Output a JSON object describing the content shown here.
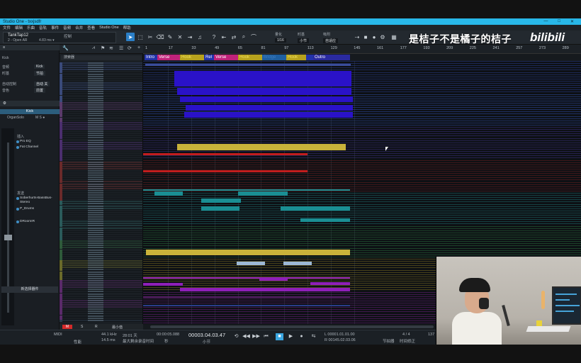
{
  "window": {
    "title": "Studio One - txxjsdfr",
    "controls": [
      "—",
      "□",
      "✕"
    ]
  },
  "menu": [
    "文件",
    "编辑",
    "乐曲",
    "音轨",
    "事件",
    "音频",
    "合并",
    "查看",
    "Studio One",
    "帮助"
  ],
  "toolbar": {
    "song_name": "TankTap12",
    "song_sub": "2 - Open AR",
    "latency": "4.83 ms ▾",
    "control_label": "控制",
    "tools": [
      "arrow",
      "range",
      "split",
      "eraser",
      "paint",
      "mute",
      "bend",
      "listen"
    ],
    "quantize_label": "量化",
    "quantize_value": "1/16",
    "timebase_label": "时基",
    "timebase_value": "小节",
    "snap_label": "吸附",
    "snap_value": "自适应"
  },
  "watermark": {
    "text": "是桔子不是橘子的桔子",
    "logo": "bilibili"
  },
  "inspector": {
    "track_name": "Kick",
    "fields": [
      {
        "label": "音频",
        "value": "Kick"
      },
      {
        "label": "时基",
        "value": "节拍"
      },
      {
        "label": "自动控制",
        "value": "自动 关"
      },
      {
        "label": "音色",
        "value": "前置"
      }
    ],
    "channel_tab": "Kick",
    "channel_sub": "OrganSolo",
    "input_label": "插入",
    "inserts": [
      "Pro EQ",
      "Fat Channel"
    ],
    "sends_label": "发送",
    "sends": [
      "Soberhurts-BassBus-Stereo",
      "P_Drums",
      "DRoomIR"
    ],
    "bottom_button": "新选择器件"
  },
  "track_list": {
    "search_placeholder": "搜索器",
    "track_colors": [
      "#3a4a7a",
      "#3a4a7a",
      "#5a3a6a",
      "#4b2e6e",
      "#4b2e6e",
      "#6a2a2a",
      "#6a2a2a",
      "#2a5a5a",
      "#2a5a5a",
      "#2e5a3a",
      "#6a6a2a",
      "#5a2a6a",
      "#5a2a6a",
      "#2a3a4a"
    ]
  },
  "ruler": {
    "bars": [
      "1",
      "17",
      "33",
      "49",
      "65",
      "81",
      "97",
      "113",
      "129",
      "145",
      "161",
      "177",
      "193",
      "209",
      "225",
      "241",
      "257",
      "273",
      "289"
    ]
  },
  "markers": [
    {
      "label": "Intro",
      "color": "#2233aa",
      "text_color": "#ffffff"
    },
    {
      "label": "Verse",
      "color": "#c0227a",
      "text_color": "#ffffff"
    },
    {
      "label": "Hook",
      "color": "#b7a21d",
      "text_color": "#f0e05a"
    },
    {
      "label": "Rel",
      "color": "#2233aa",
      "text_color": "#ffffff"
    },
    {
      "label": "Verse",
      "color": "#c0227a",
      "text_color": "#ffffff"
    },
    {
      "label": "Hook",
      "color": "#b7a21d",
      "text_color": "#f0e05a"
    },
    {
      "label": "Bridge",
      "color": "#1f5fa0",
      "text_color": "#3c7cc0"
    },
    {
      "label": "Hook",
      "color": "#b7a21d",
      "text_color": "#f0e05a"
    },
    {
      "label": "",
      "color": "#2233aa",
      "text_color": "#ffffff"
    },
    {
      "label": "Outro",
      "color": "#2a2aa0",
      "text_color": "#ffffff"
    }
  ],
  "bottom_tabs": {
    "indicator": "M",
    "items": [
      "S",
      "R",
      "最小值"
    ]
  },
  "transport": {
    "midi_label": "MIDI",
    "perf_label": "性能",
    "sample_rate": "44.1 kHz",
    "latency": "14.5 ms",
    "record_time": "28:01 天",
    "record_time_label": "最大剩余录音时间",
    "seconds": "00:00:05.088",
    "seconds_label": "秒",
    "position": "00003.04.03.47",
    "position_label": "小节",
    "loop_start": "L 00001.01.01.00",
    "loop_end": "R 00145.02.03.06",
    "signature": "4 / 4",
    "signature_label": "拍号",
    "tempo": "137",
    "tempo_label": "速度",
    "metronome_label": "节拍器",
    "timecorrect_label": "时间修正"
  },
  "colors": {
    "accent": "#28b7e8",
    "blue_clip": "#2a12c8",
    "yellow_clip": "#c9b33a",
    "red_clip": "#c21d1d",
    "teal_clip": "#1a8e93",
    "purple_clip": "#8e1fb8"
  }
}
